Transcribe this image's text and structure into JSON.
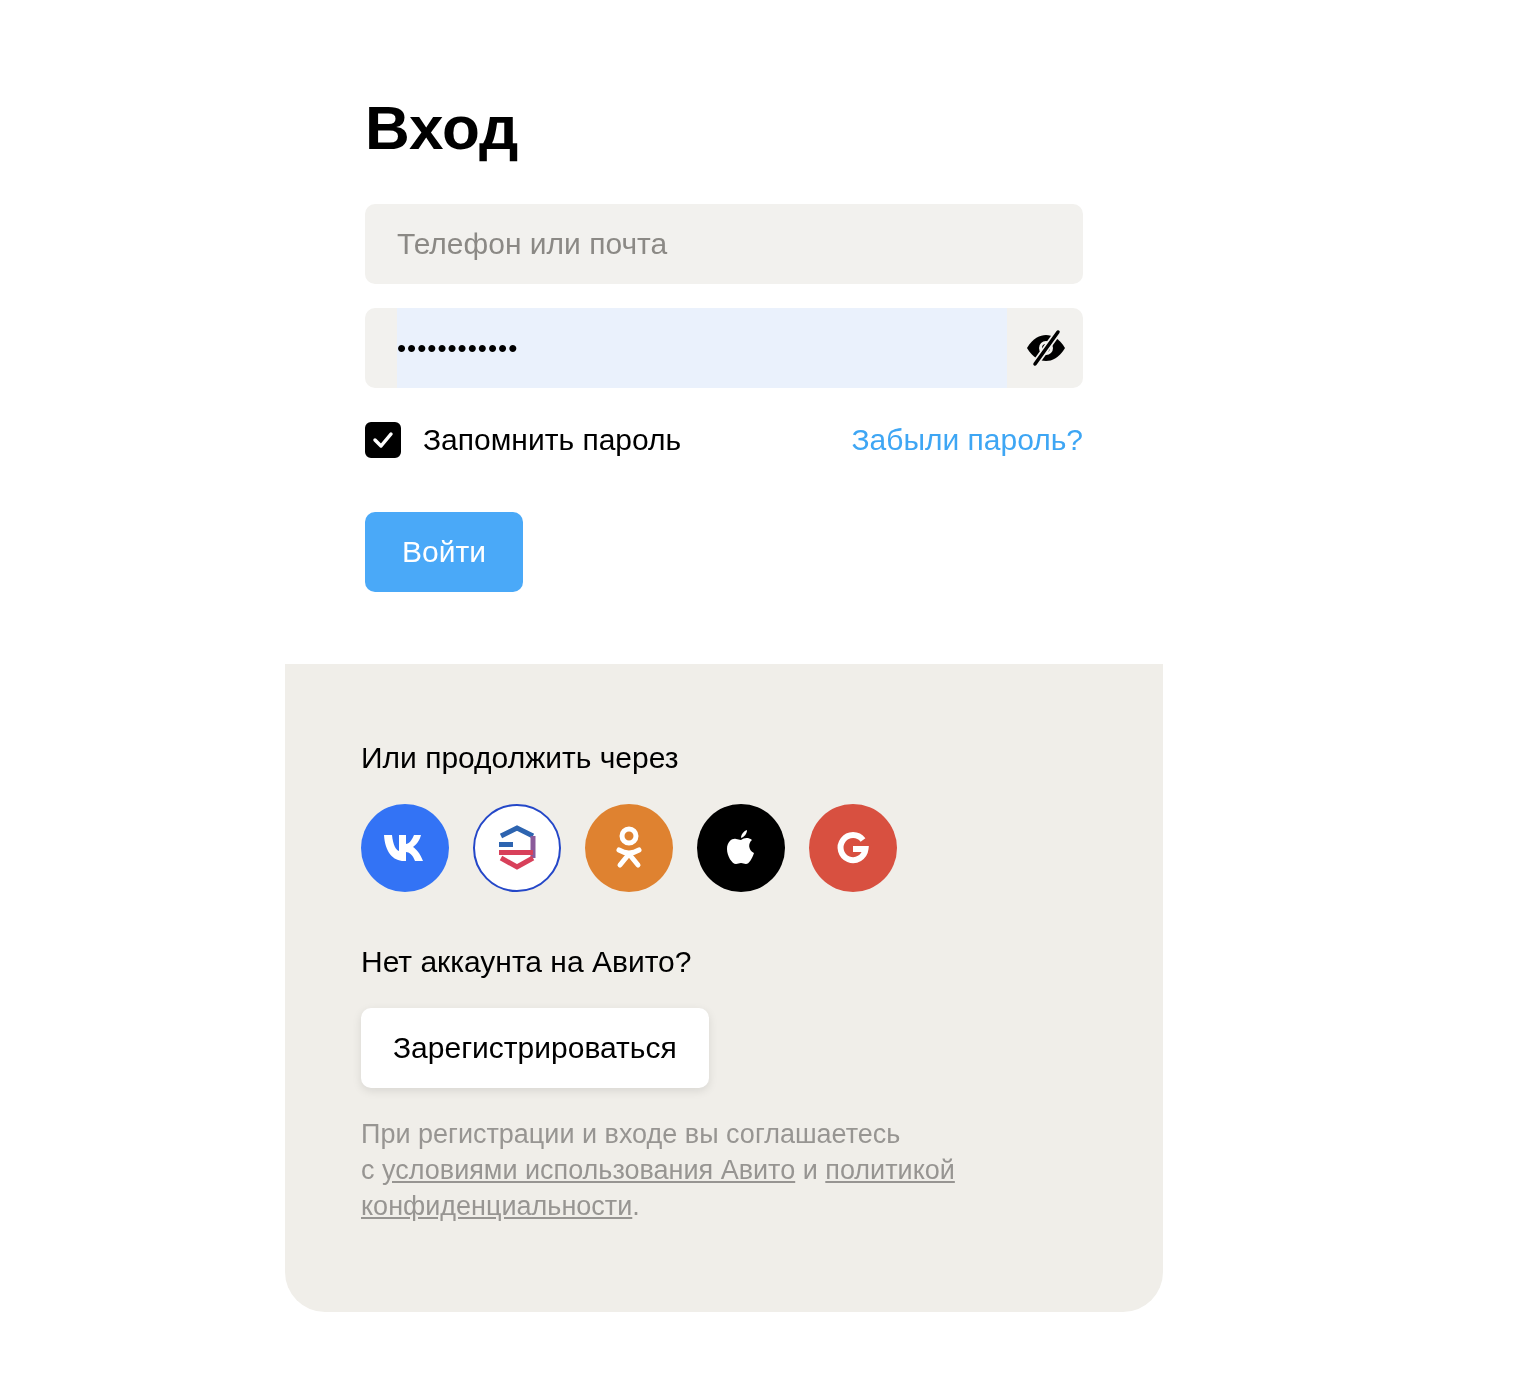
{
  "title": "Вход",
  "login_field": {
    "placeholder": "Телефон или почта"
  },
  "password_field": {
    "value": "••••••••••••",
    "autofilled": true
  },
  "remember": {
    "label": "Запомнить пароль",
    "checked": true
  },
  "forgot_link": "Забыли пароль?",
  "submit_button": "Войти",
  "social": {
    "heading": "Или продолжить через",
    "providers": [
      {
        "kind": "vk",
        "color": "#3373f5"
      },
      {
        "kind": "gosuslugi",
        "color": "#ffffff"
      },
      {
        "kind": "ok",
        "color": "#df8230"
      },
      {
        "kind": "apple",
        "color": "#000000"
      },
      {
        "kind": "google",
        "color": "#d85040"
      }
    ]
  },
  "signup": {
    "question": "Нет аккаунта на Авито?",
    "button": "Зарегистрироваться"
  },
  "legal": [
    {
      "kind": "text",
      "text": "При регистрации и входе вы соглашаетесь"
    },
    {
      "kind": "break"
    },
    {
      "kind": "text",
      "text": "с "
    },
    {
      "kind": "link",
      "text": "условиями использования Авито"
    },
    {
      "kind": "text",
      "text": " и "
    },
    {
      "kind": "link",
      "text": "политикой"
    },
    {
      "kind": "break"
    },
    {
      "kind": "link",
      "text": "конфиденциальности"
    },
    {
      "kind": "text",
      "text": "."
    }
  ]
}
